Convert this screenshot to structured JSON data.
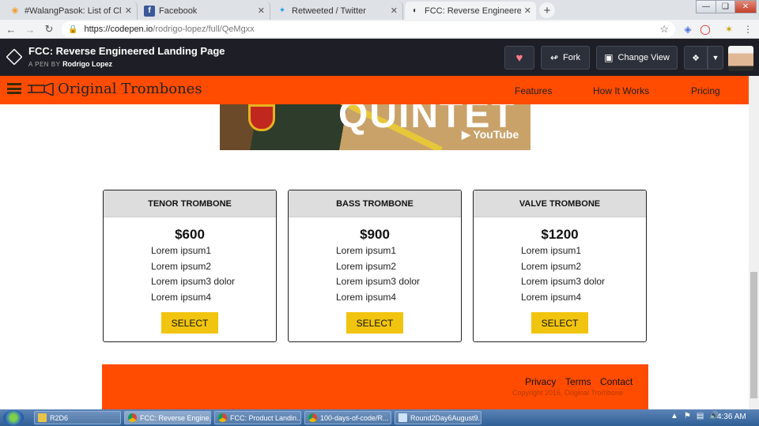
{
  "browser": {
    "tabs": [
      {
        "label": "#WalangPasok: List of Class susp",
        "icon": "map-pin-icon",
        "color": "#f0a030"
      },
      {
        "label": "Facebook",
        "icon": "facebook-icon",
        "color": "#3b5998"
      },
      {
        "label": "Retweeted / Twitter",
        "icon": "twitter-icon",
        "color": "#1da1f2"
      },
      {
        "label": "FCC: Reverse Engineered Landing",
        "icon": "codepen-icon",
        "color": "#333333"
      }
    ],
    "url_host": "https://codepen.io",
    "url_path": "/rodrigo-lopez/full/QeMgxx"
  },
  "codepen": {
    "title": "FCC: Reverse Engineered Landing Page",
    "by_prefix": "A PEN BY",
    "author": "Rodrigo Lopez",
    "fork_label": "Fork",
    "change_view_label": "Change View"
  },
  "site": {
    "brand": "Original Trombones",
    "nav": [
      "Features",
      "How It Works",
      "Pricing"
    ],
    "video_overlay": "QUINTET",
    "video_brand": "YouTube",
    "accent": "#ff4c00",
    "button_color": "#f1c40f",
    "plans": [
      {
        "name": "TENOR TROMBONE",
        "price": "$600",
        "features": [
          "Lorem ipsum1",
          "Lorem ipsum2",
          "Lorem ipsum3 dolor",
          "Lorem ipsum4"
        ],
        "button": "SELECT"
      },
      {
        "name": "BASS TROMBONE",
        "price": "$900",
        "features": [
          "Lorem ipsum1",
          "Lorem ipsum2",
          "Lorem ipsum3 dolor",
          "Lorem ipsum4"
        ],
        "button": "SELECT"
      },
      {
        "name": "VALVE TROMBONE",
        "price": "$1200",
        "features": [
          "Lorem ipsum1",
          "Lorem ipsum2",
          "Lorem ipsum3 dolor",
          "Lorem ipsum4"
        ],
        "button": "SELECT"
      }
    ],
    "footer_links": [
      "Privacy",
      "Terms",
      "Contact"
    ],
    "copyright": "Copyright 2016, Original Trombone"
  },
  "taskbar": {
    "items": [
      {
        "label": "R2D6",
        "icon": "folder-icon"
      },
      {
        "label": "FCC: Reverse Engine...",
        "icon": "chrome-icon"
      },
      {
        "label": "FCC: Product Landin...",
        "icon": "chrome-icon"
      },
      {
        "label": "100-days-of-code/R...",
        "icon": "chrome-icon"
      },
      {
        "label": "Round2Day6August9....",
        "icon": "notepad-icon"
      }
    ],
    "clock": "4:36 AM"
  }
}
